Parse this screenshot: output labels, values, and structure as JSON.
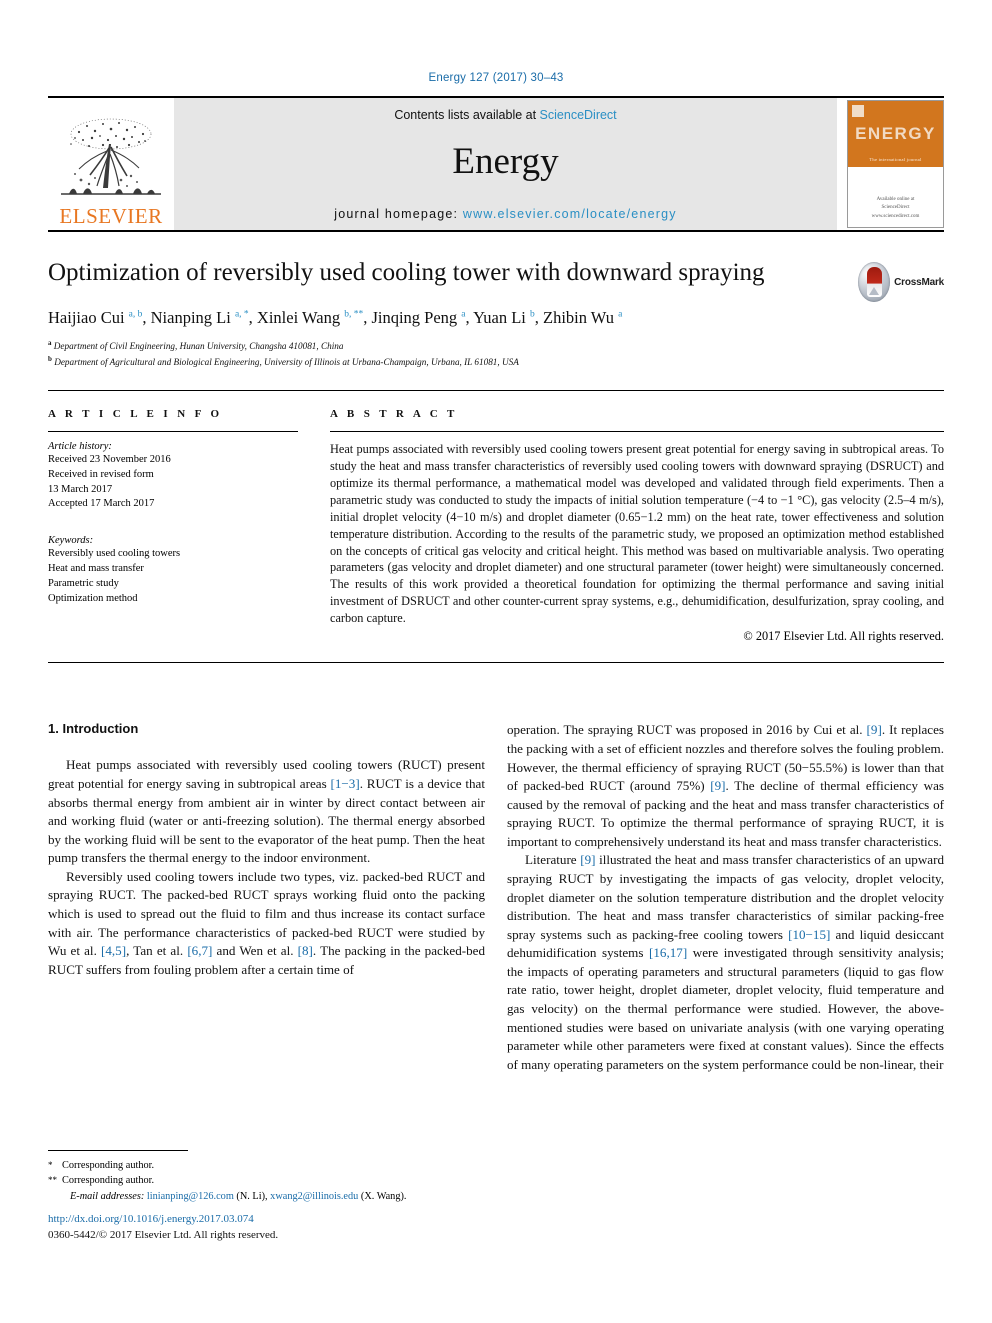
{
  "running_head": "Energy 127 (2017) 30–43",
  "masthead": {
    "publisher": "ELSEVIER",
    "contents_prefix": "Contents lists available at ",
    "contents_link": "ScienceDirect",
    "journal_name": "Energy",
    "homepage_prefix": "journal homepage: ",
    "homepage_url": "www.elsevier.com/locate/energy",
    "cover_title": "ENERGY",
    "cover_tagline": "The international journal",
    "cover_footer": "Available online at",
    "cover_footer2": "ScienceDirect",
    "cover_footer3": "www.sciencedirect.com"
  },
  "article": {
    "title": "Optimization of reversibly used cooling tower with downward spraying",
    "crossmark_label": "CrossMark",
    "authors_html": "Haijiao Cui <sup>a, b</sup>, Nianping Li <sup>a, *</sup>, Xinlei Wang <sup>b, **</sup>, Jinqing Peng <sup>a</sup>, Yuan Li <sup>b</sup>, Zhibin Wu <sup>a</sup>",
    "affiliations": [
      {
        "mark": "a",
        "text": "Department of Civil Engineering, Hunan University, Changsha 410081, China"
      },
      {
        "mark": "b",
        "text": "Department of Agricultural and Biological Engineering, University of Illinois at Urbana-Champaign, Urbana, IL 61081, USA"
      }
    ]
  },
  "article_info": {
    "heading": "A R T I C L E   I N F O",
    "history_label": "Article history:",
    "history": [
      "Received 23 November 2016",
      "Received in revised form",
      "13 March 2017",
      "Accepted 17 March 2017"
    ],
    "keywords_label": "Keywords:",
    "keywords": [
      "Reversibly used cooling towers",
      "Heat and mass transfer",
      "Parametric study",
      "Optimization method"
    ]
  },
  "abstract": {
    "heading": "A B S T R A C T",
    "text": "Heat pumps associated with reversibly used cooling towers present great potential for energy saving in subtropical areas. To study the heat and mass transfer characteristics of reversibly used cooling towers with downward spraying (DSRUCT) and optimize its thermal performance, a mathematical model was developed and validated through field experiments. Then a parametric study was conducted to study the impacts of initial solution temperature (−4 to −1 °C), gas velocity (2.5–4 m/s), initial droplet velocity (4−10 m/s) and droplet diameter (0.65−1.2 mm) on the heat rate, tower effectiveness and solution temperature distribution. According to the results of the parametric study, we proposed an optimization method established on the concepts of critical gas velocity and critical height. This method was based on multivariable analysis. Two operating parameters (gas velocity and droplet diameter) and one structural parameter (tower height) were simultaneously concerned. The results of this work provided a theoretical foundation for optimizing the thermal performance and saving initial investment of DSRUCT and other counter-current spray systems, e.g., dehumidification, desulfurization, spray cooling, and carbon capture.",
    "copyright": "© 2017 Elsevier Ltd. All rights reserved."
  },
  "body": {
    "section_title": "1. Introduction",
    "left_paragraphs": [
      {
        "segments": [
          {
            "t": "Heat pumps associated with reversibly used cooling towers (RUCT) present great potential for energy saving in subtropical areas "
          },
          {
            "t": "[1−3]",
            "ref": true
          },
          {
            "t": ". RUCT is a device that absorbs thermal energy from ambient air in winter by direct contact between air and working fluid (water or anti-freezing solution). The thermal energy absorbed by the working fluid will be sent to the evaporator of the heat pump. Then the heat pump transfers the thermal energy to the indoor environment."
          }
        ]
      },
      {
        "segments": [
          {
            "t": "Reversibly used cooling towers include two types, viz. packed-bed RUCT and spraying RUCT. The packed-bed RUCT sprays working fluid onto the packing which is used to spread out the fluid to film and thus increase its contact surface with air. The performance characteristics of packed-bed RUCT were studied by Wu et al. "
          },
          {
            "t": "[4,5]",
            "ref": true
          },
          {
            "t": ", Tan et al. "
          },
          {
            "t": "[6,7]",
            "ref": true
          },
          {
            "t": " and Wen et al. "
          },
          {
            "t": "[8]",
            "ref": true
          },
          {
            "t": ". The packing in the packed-bed RUCT suffers from fouling problem after a certain time of"
          }
        ]
      }
    ],
    "right_paragraphs": [
      {
        "segments": [
          {
            "t": "operation. The spraying RUCT was proposed in 2016 by Cui et al. "
          },
          {
            "t": "[9]",
            "ref": true
          },
          {
            "t": ". It replaces the packing with a set of efficient nozzles and therefore solves the fouling problem. However, the thermal efficiency of spraying RUCT (50−55.5%) is lower than that of packed-bed RUCT (around 75%) "
          },
          {
            "t": "[9]",
            "ref": true
          },
          {
            "t": ". The decline of thermal efficiency was caused by the removal of packing and the heat and mass transfer characteristics of spraying RUCT. To optimize the thermal performance of spraying RUCT, it is important to comprehensively understand its heat and mass transfer characteristics."
          }
        ],
        "noindent": true
      },
      {
        "segments": [
          {
            "t": "Literature "
          },
          {
            "t": "[9]",
            "ref": true
          },
          {
            "t": " illustrated the heat and mass transfer characteristics of an upward spraying RUCT by investigating the impacts of gas velocity, droplet velocity, droplet diameter on the solution temperature distribution and the droplet velocity distribution. The heat and mass transfer characteristics of similar packing-free spray systems such as packing-free cooling towers "
          },
          {
            "t": "[10−15]",
            "ref": true
          },
          {
            "t": " and liquid desiccant dehumidification systems "
          },
          {
            "t": "[16,17]",
            "ref": true
          },
          {
            "t": " were investigated through sensitivity analysis; the impacts of operating parameters and structural parameters (liquid to gas flow rate ratio, tower height, droplet diameter, droplet velocity, fluid temperature and gas velocity) on the thermal performance were studied. However, the above-mentioned studies were based on univariate analysis (with one varying operating parameter while other parameters were fixed at constant values). Since the effects of many operating parameters on the system performance could be non-linear, their"
          }
        ]
      }
    ]
  },
  "footnotes": {
    "corresponding1_mark": "*",
    "corresponding1": "Corresponding author.",
    "corresponding2_mark": "**",
    "corresponding2": "Corresponding author.",
    "emails_label": "E-mail addresses:",
    "email1": "linianping@126.com",
    "email1_owner": "(N. Li)",
    "email2": "xwang2@illinois.edu",
    "email2_owner": "(X. Wang).",
    "doi": "http://dx.doi.org/10.1016/j.energy.2017.03.074",
    "issn": "0360-5442/© 2017 Elsevier Ltd. All rights reserved."
  },
  "colors": {
    "link": "#1a6ca8",
    "sciencedirect": "#2a8fc4",
    "elsevier_orange": "#E87722",
    "cover_orange": "#D2761E",
    "banner_bg": "#e6e6e6"
  }
}
